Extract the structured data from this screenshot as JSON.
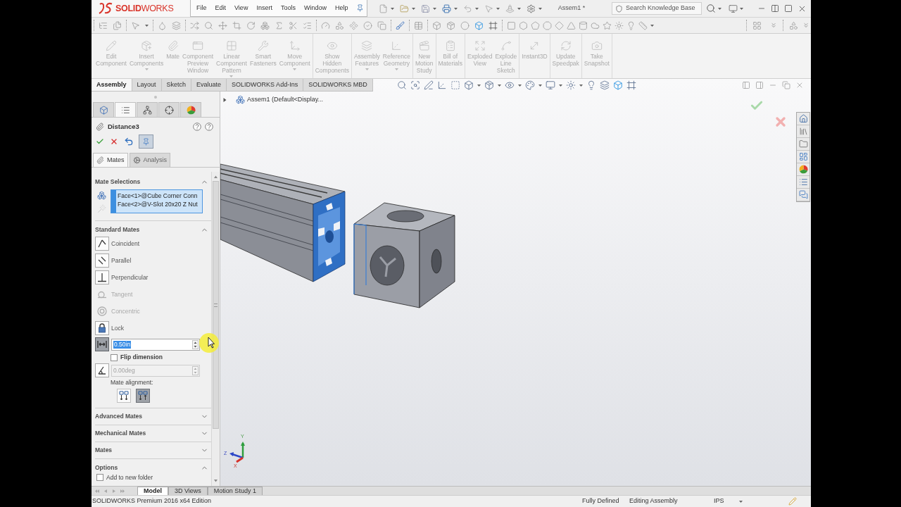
{
  "title_bar": {
    "logo": "**SOLID**WORKS",
    "menu": [
      "File",
      "Edit",
      "View",
      "Insert",
      "Tools",
      "Window",
      "Help"
    ],
    "document_title": "Assem1 *",
    "search": {
      "placeholder": "Search Knowledge Base"
    }
  },
  "command_manager": {
    "groups": [
      {
        "buttons": [
          {
            "label": "Edit\nComponent",
            "disabled": true,
            "dropdown": false
          },
          {
            "label": "Insert\nComponents",
            "disabled": true,
            "dropdown": true
          },
          {
            "label": "Mate",
            "disabled": true,
            "dropdown": false
          },
          {
            "label": "Component\nPreview\nWindow",
            "disabled": true,
            "dropdown": false
          },
          {
            "label": "Linear\nComponent\nPattern",
            "disabled": true,
            "dropdown": true
          },
          {
            "label": "Smart\nFasteners",
            "disabled": true,
            "dropdown": false
          },
          {
            "label": "Move\nComponent",
            "disabled": true,
            "dropdown": true
          }
        ]
      },
      {
        "buttons": [
          {
            "label": "Show\nHidden\nComponents",
            "disabled": true,
            "dropdown": false
          }
        ]
      },
      {
        "buttons": [
          {
            "label": "Assembly\nFeatures",
            "disabled": true,
            "dropdown": true
          },
          {
            "label": "Reference\nGeometry",
            "disabled": true,
            "dropdown": true
          }
        ]
      },
      {
        "buttons": [
          {
            "label": "New\nMotion\nStudy",
            "disabled": true,
            "dropdown": false
          }
        ]
      },
      {
        "buttons": [
          {
            "label": "Bill of\nMaterials",
            "disabled": true,
            "dropdown": false
          }
        ]
      },
      {
        "buttons": [
          {
            "label": "Exploded\nView",
            "disabled": true,
            "dropdown": false
          },
          {
            "label": "Explode\nLine\nSketch",
            "disabled": true,
            "dropdown": false
          }
        ]
      },
      {
        "buttons": [
          {
            "label": "Instant3D",
            "disabled": true,
            "dropdown": false
          }
        ]
      },
      {
        "buttons": [
          {
            "label": "Update\nSpeedpak",
            "disabled": true,
            "dropdown": false
          }
        ]
      },
      {
        "buttons": [
          {
            "label": "Take\nSnapshot",
            "disabled": true,
            "dropdown": false
          }
        ]
      }
    ]
  },
  "command_tabs": [
    {
      "label": "Assembly",
      "selected": true
    },
    {
      "label": "Layout",
      "selected": false
    },
    {
      "label": "Sketch",
      "selected": false
    },
    {
      "label": "Evaluate",
      "selected": false
    },
    {
      "label": "SOLIDWORKS Add-Ins",
      "selected": false
    },
    {
      "label": "SOLIDWORKS MBD",
      "selected": false
    }
  ],
  "property_manager": {
    "panel_tabs": [
      {
        "selected": false
      },
      {
        "selected": true
      },
      {
        "selected": false
      },
      {
        "selected": false
      },
      {
        "selected": false
      }
    ],
    "title": "Distance3",
    "pinned": true,
    "tabs": [
      {
        "label": "Mates",
        "selected": true
      },
      {
        "label": "Analysis",
        "selected": false
      }
    ],
    "sections": [
      {
        "kind": "selections",
        "title": "Mate Selections",
        "expanded": true,
        "active": true,
        "items": [
          "Face<1>@Cube Corner Conn",
          "Face<2>@V-Slot 20x20 Z Nut"
        ]
      },
      {
        "kind": "standard",
        "title": "Standard Mates",
        "expanded": true,
        "mates": [
          {
            "label": "Coincident",
            "disabled": false,
            "selected": false
          },
          {
            "label": "Parallel",
            "disabled": false,
            "selected": false
          },
          {
            "label": "Perpendicular",
            "disabled": false,
            "selected": false
          },
          {
            "label": "Tangent",
            "disabled": true,
            "selected": false
          },
          {
            "label": "Concentric",
            "disabled": true,
            "selected": false
          },
          {
            "label": "Lock",
            "disabled": false,
            "selected": false
          }
        ],
        "distance": {
          "value": "0.50in",
          "selected": true,
          "value_highlighted": true
        },
        "flip_dimension": {
          "label": "Flip dimension",
          "checked": false
        },
        "angle": {
          "value": "0.00deg",
          "disabled": true,
          "selected": false
        },
        "mate_alignment": {
          "label": "Mate alignment:",
          "options": [
            {
              "selected": false
            },
            {
              "selected": true
            }
          ]
        }
      },
      {
        "kind": "plain",
        "title": "Advanced Mates",
        "expanded": false
      },
      {
        "kind": "plain",
        "title": "Mechanical Mates",
        "expanded": false
      },
      {
        "kind": "plain",
        "title": "Mates",
        "expanded": false
      },
      {
        "kind": "options",
        "title": "Options",
        "expanded": true,
        "options": [
          {
            "label": "Add to new folder",
            "checked": false
          }
        ]
      }
    ]
  },
  "graphics": {
    "tree": {
      "label": "Assem1 (Default<Display...",
      "expanded": false
    },
    "triad": {
      "x": "X",
      "y": "Y",
      "z": "Z"
    }
  },
  "model_tabs": [
    {
      "label": "Model",
      "selected": true
    },
    {
      "label": "3D Views",
      "selected": false
    },
    {
      "label": "Motion Study 1",
      "selected": false
    }
  ],
  "status_bar": {
    "edition": "SOLIDWORKS Premium 2016 x64 Edition",
    "status": "Fully Defined",
    "mode": "Editing Assembly",
    "units": "IPS"
  }
}
